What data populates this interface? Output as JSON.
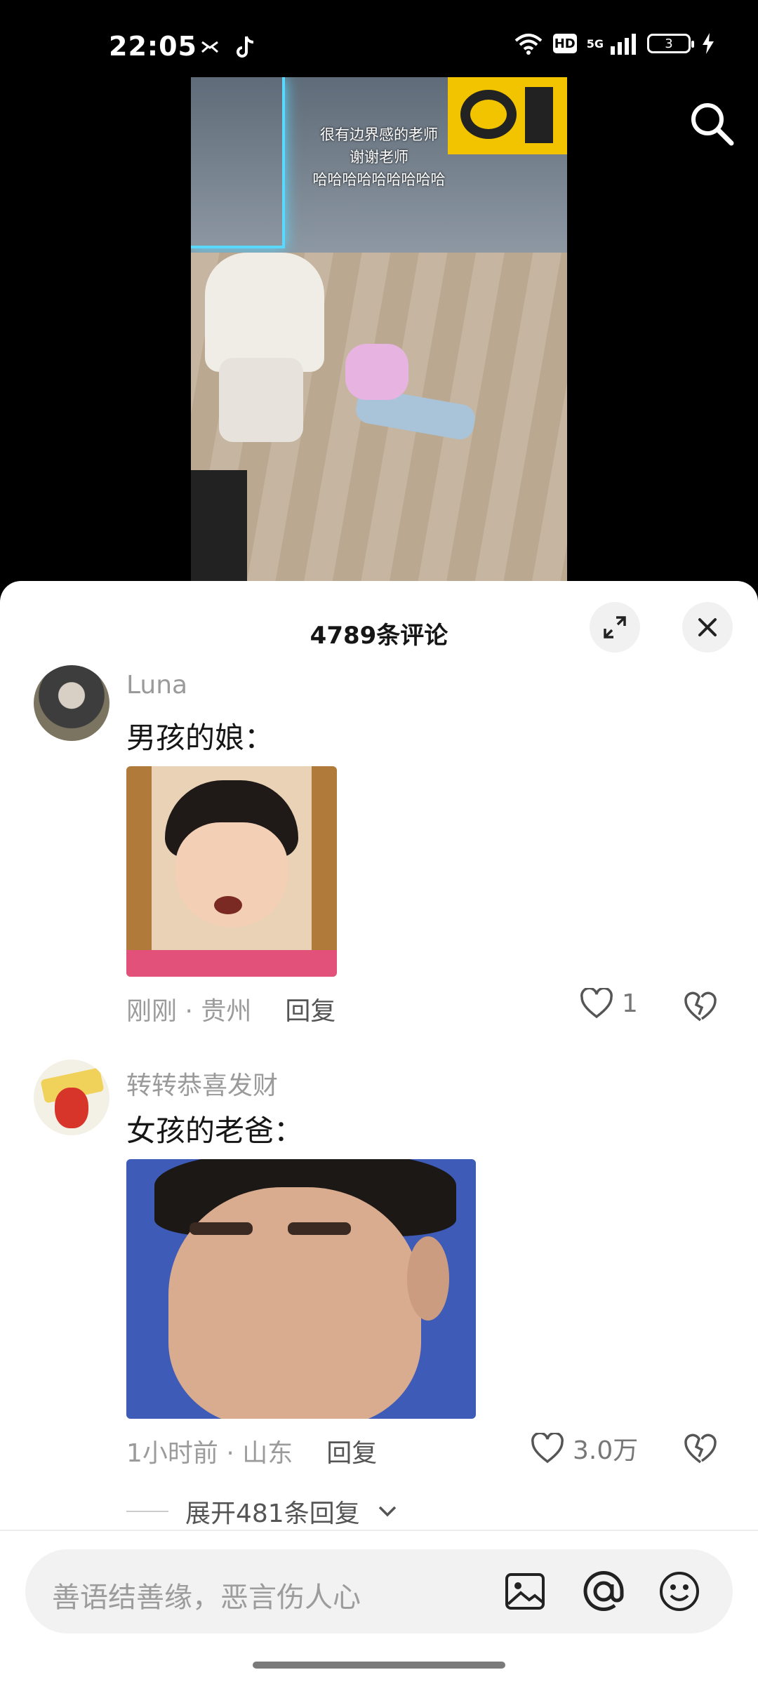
{
  "status_bar": {
    "time": "22:05",
    "hd": "HD",
    "network": "5G",
    "battery": "3",
    "icons": [
      "mail-icon",
      "tiktok-icon",
      "wifi-icon",
      "signal-icon",
      "charging-icon"
    ]
  },
  "video": {
    "captions": [
      "很有边界感的老师",
      "谢谢老师",
      "哈哈哈哈哈哈哈哈哈"
    ]
  },
  "comments_panel": {
    "title": "4789条评论",
    "comments": [
      {
        "username": "Luna",
        "text": "男孩的娘：",
        "time_location": "刚刚 · 贵州",
        "reply_label": "回复",
        "likes": "1"
      },
      {
        "username": "转转恭喜发财",
        "text": "女孩的老爸：",
        "time_location": "1小时前 · 山东",
        "reply_label": "回复",
        "likes": "3.0万",
        "expand_label": "展开481条回复"
      }
    ],
    "input_placeholder": "善语结善缘，恶言伤人心",
    "input_icons": [
      "image-icon",
      "at-icon",
      "emoji-icon"
    ]
  }
}
